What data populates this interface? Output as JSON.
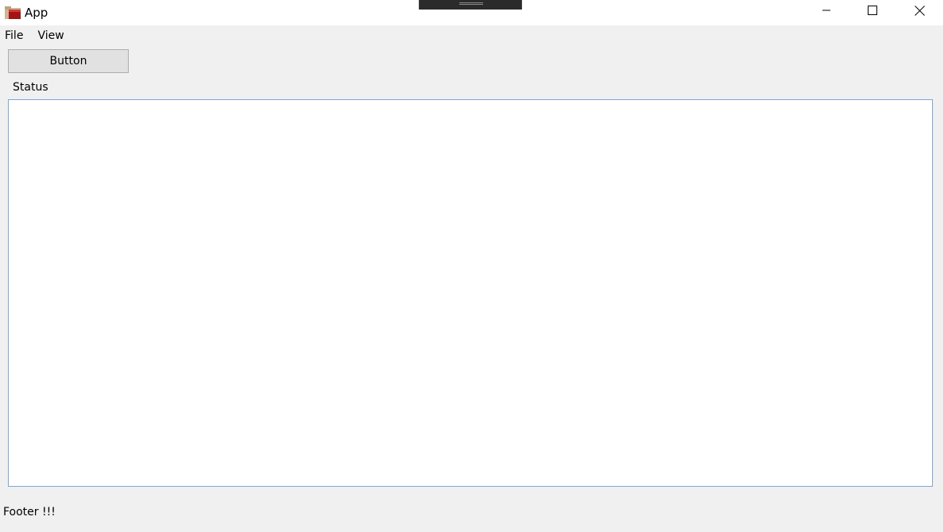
{
  "window": {
    "title": "App",
    "icon": "folder-app-icon",
    "controls": {
      "minimize_icon": "minimize-icon",
      "maximize_icon": "maximize-icon",
      "close_icon": "close-icon"
    }
  },
  "menu": {
    "items": [
      {
        "label": "File"
      },
      {
        "label": "View"
      }
    ]
  },
  "main": {
    "button_label": "Button",
    "status_label": "Status",
    "status_text": ""
  },
  "footer": {
    "text": "Footer !!!"
  },
  "colors": {
    "titlebar_bg": "#ffffff",
    "window_bg": "#f0f0f0",
    "button_bg": "#e1e1e1",
    "textbox_border": "#7aa7d8"
  }
}
